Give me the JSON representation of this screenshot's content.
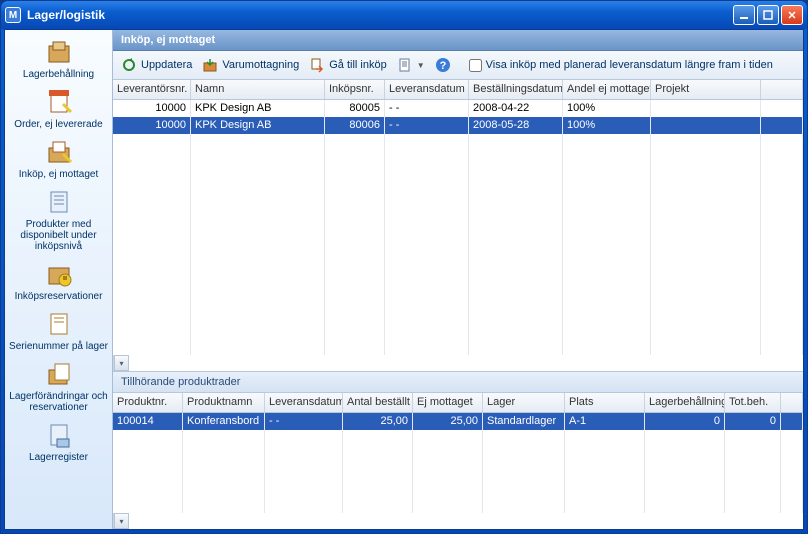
{
  "window": {
    "title": "Lager/logistik",
    "app_icon_text": "M"
  },
  "sidebar": {
    "items": [
      {
        "label": "Lagerbehållning",
        "name": "lagerbehallning"
      },
      {
        "label": "Order, ej levererade",
        "name": "order-ej-levererade"
      },
      {
        "label": "Inköp, ej mottaget",
        "name": "inkop-ej-mottaget"
      },
      {
        "label": "Produkter med disponibelt under inköpsnivå",
        "name": "produkter-disponibelt"
      },
      {
        "label": "Inköpsreservationer",
        "name": "inkopsreservationer"
      },
      {
        "label": "Serienummer på lager",
        "name": "serienummer"
      },
      {
        "label": "Lagerförändringar och reservationer",
        "name": "lagerforandringar"
      },
      {
        "label": "Lagerregister",
        "name": "lagerregister"
      }
    ]
  },
  "panel": {
    "title": "Inköp, ej mottaget"
  },
  "toolbar": {
    "refresh": "Uppdatera",
    "receive": "Varumottagning",
    "goto": "Gå till inköp",
    "checkbox_label": "Visa inköp med planerad leveransdatum längre fram i tiden"
  },
  "grid": {
    "columns": [
      {
        "label": "Leverantörsnr.",
        "w": 78,
        "align": "right"
      },
      {
        "label": "Namn",
        "w": 134,
        "align": "left"
      },
      {
        "label": "Inköpsnr.",
        "w": 60,
        "align": "right"
      },
      {
        "label": "Leveransdatum",
        "w": 84,
        "align": "left"
      },
      {
        "label": "Beställningsdatum",
        "w": 94,
        "align": "left"
      },
      {
        "label": "Andel ej mottaget",
        "w": 88,
        "align": "left"
      },
      {
        "label": "Projekt",
        "w": 110,
        "align": "left"
      }
    ],
    "rows": [
      {
        "leverantorsnr": "10000",
        "namn": "KPK Design AB",
        "inkopsnr": "80005",
        "leveransdatum": "- -",
        "bestallningsdatum": "2008-04-22",
        "andel": "100%",
        "projekt": "",
        "selected": false
      },
      {
        "leverantorsnr": "10000",
        "namn": "KPK Design AB",
        "inkopsnr": "80006",
        "leveransdatum": "- -",
        "bestallningsdatum": "2008-05-28",
        "andel": "100%",
        "projekt": "",
        "selected": true
      }
    ]
  },
  "subpanel": {
    "title": "Tillhörande produktrader"
  },
  "grid2": {
    "columns": [
      {
        "label": "Produktnr.",
        "w": 70,
        "align": "left"
      },
      {
        "label": "Produktnamn",
        "w": 82,
        "align": "left"
      },
      {
        "label": "Leveransdatum",
        "w": 78,
        "align": "left"
      },
      {
        "label": "Antal beställt",
        "w": 70,
        "align": "right"
      },
      {
        "label": "Ej mottaget",
        "w": 70,
        "align": "right"
      },
      {
        "label": "Lager",
        "w": 82,
        "align": "left"
      },
      {
        "label": "Plats",
        "w": 80,
        "align": "left"
      },
      {
        "label": "Lagerbehållning",
        "w": 80,
        "align": "right"
      },
      {
        "label": "Tot.beh.",
        "w": 56,
        "align": "right"
      }
    ],
    "rows": [
      {
        "produktnr": "100014",
        "produktnamn": "Konferansbord",
        "leveransdatum": "- -",
        "antal": "25,00",
        "ejmottaget": "25,00",
        "lager": "Standardlager",
        "plats": "A-1",
        "lagerbeh": "0",
        "totbeh": "0",
        "selected": true
      }
    ]
  }
}
